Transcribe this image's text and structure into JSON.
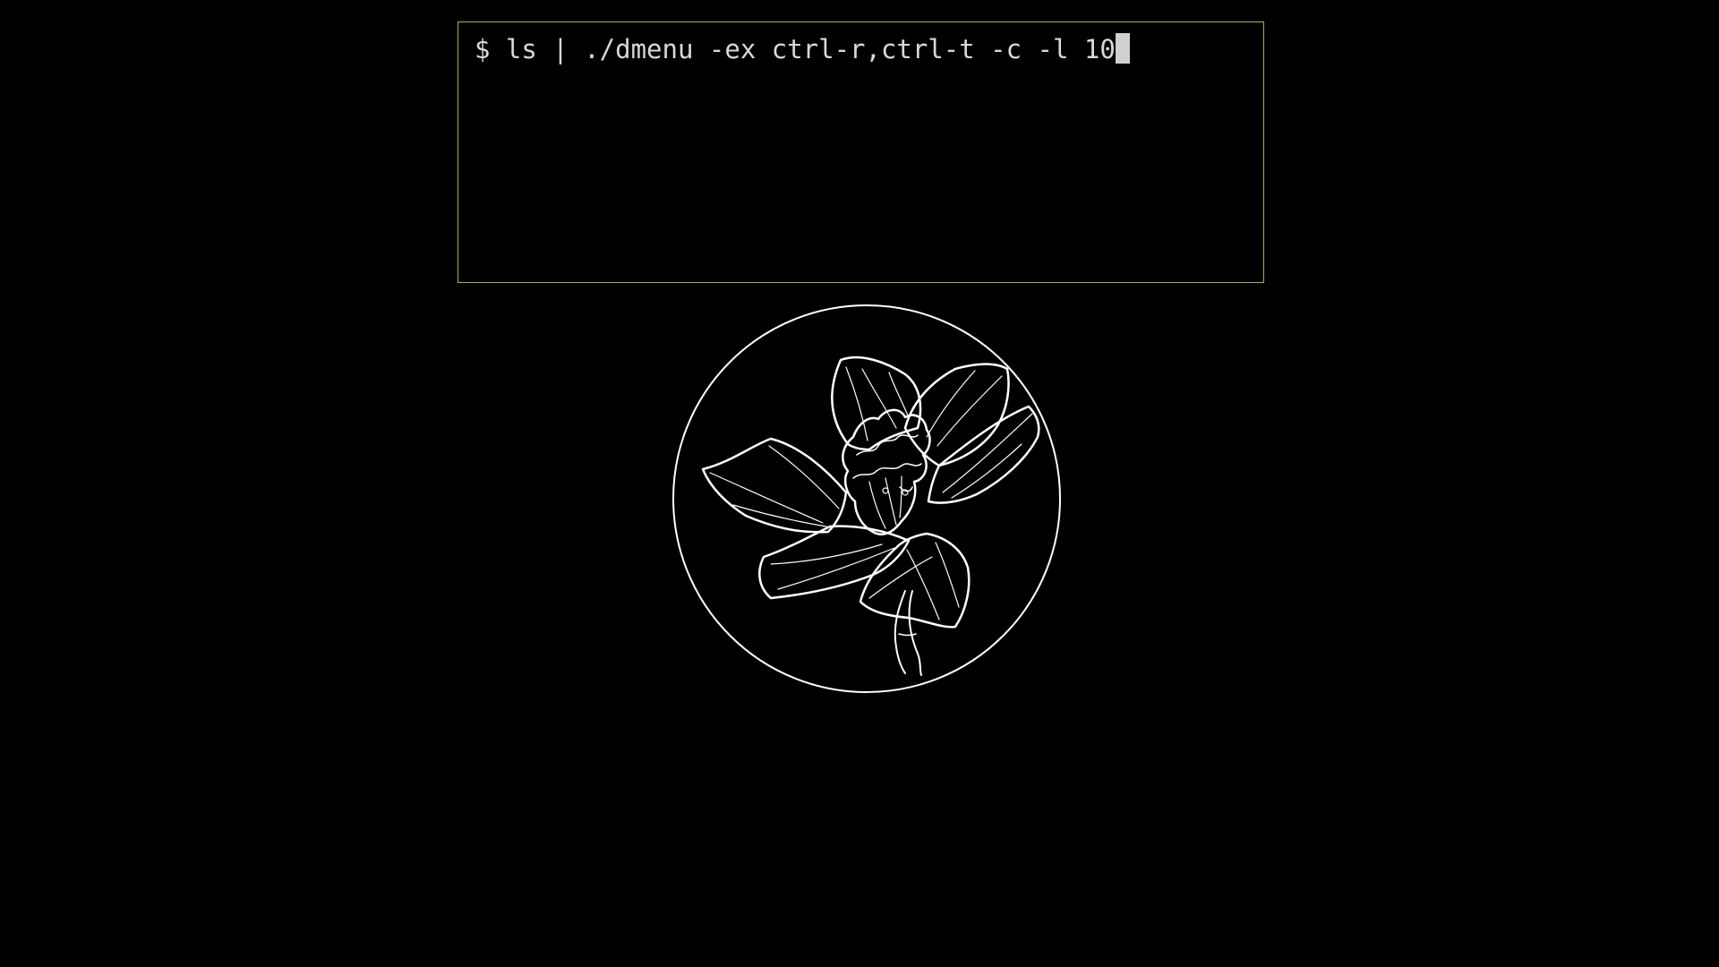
{
  "terminal": {
    "prompt": "$ ",
    "command": "ls | ./dmenu -ex ctrl-r,ctrl-t -c -l 10",
    "border_color": "#a6b832",
    "text_color": "#d8d8d8",
    "cursor_color": "#d0d0d0"
  },
  "wallpaper": {
    "icon": "daffodil-flower-icon",
    "line_color": "#ffffff",
    "background_color": "#000000"
  }
}
